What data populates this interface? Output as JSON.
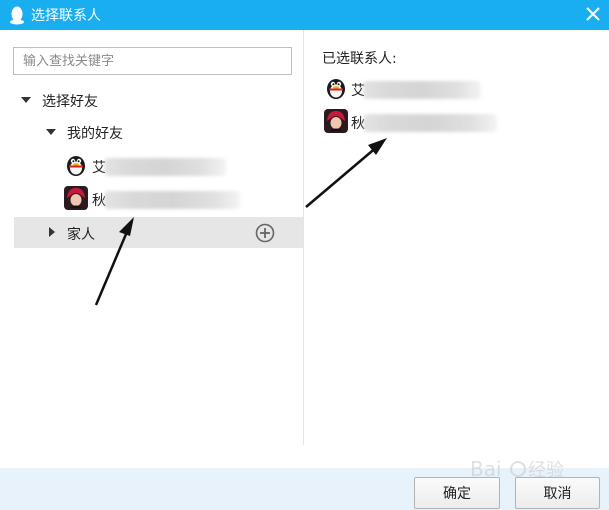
{
  "window": {
    "title": "选择联系人",
    "close_icon": "close-icon",
    "app_icon": "qq-penguin-icon",
    "titlebar_color": "#19aef0"
  },
  "search": {
    "placeholder": "输入查找关键字",
    "value": ""
  },
  "tree": {
    "root_label": "选择好友",
    "group_mine": "我的好友",
    "contacts": [
      {
        "prefix": "艾",
        "avatar": "penguin-avatar-icon"
      },
      {
        "prefix": "秋",
        "avatar": "red-hair-avatar-icon"
      }
    ],
    "group_family": "家人",
    "add_icon": "plus-circle-icon"
  },
  "right": {
    "title": "已选联系人:",
    "selected": [
      {
        "prefix": "艾",
        "avatar": "penguin-avatar-icon"
      },
      {
        "prefix": "秋",
        "avatar": "red-hair-avatar-icon"
      }
    ]
  },
  "buttons": {
    "ok": "确定",
    "cancel": "取消"
  },
  "colors": {
    "selected_row": "#e6e6e6",
    "bottom_bar": "#e8f2fa"
  }
}
